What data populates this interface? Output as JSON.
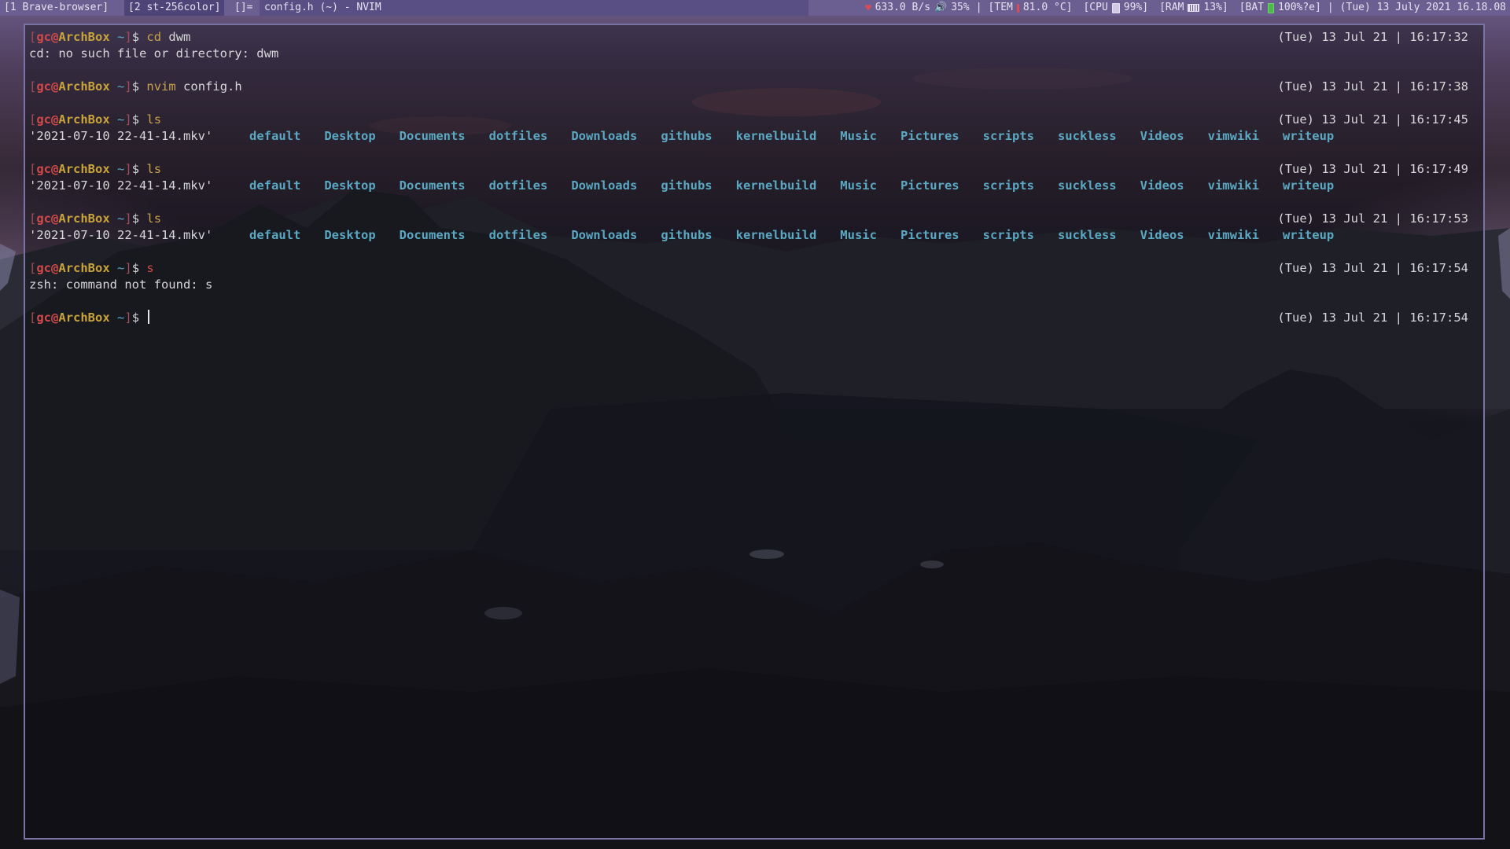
{
  "bar": {
    "tags": [
      {
        "label": "[1 Brave-browser]",
        "active": false
      },
      {
        "label": "[2 st-256color]",
        "active": true
      }
    ],
    "layout": "[]=",
    "window_title": "config.h (~) - NVIM",
    "status": {
      "net": "633.0 B/s",
      "volume": "35%",
      "sep1": "|",
      "temp_open": "[TEM",
      "temp": "81.0 °C]",
      "cpu_open": "[CPU",
      "cpu": "99%]",
      "ram_open": "[RAM",
      "ram": "13%]",
      "bat_open": "[BAT",
      "bat": "100%?e]",
      "sep2": "|",
      "datetime": "(Tue) 13 July 2021 16.18.08"
    },
    "colors": {
      "bar_bg": "#6b5f92",
      "active_tag_bg": "#4e4478",
      "title_bg": "#5a4f85"
    }
  },
  "terminal": {
    "prompt": {
      "open": "[",
      "user": "gc",
      "at": "@",
      "host": "ArchBox",
      "path": " ~",
      "close": "]",
      "dollar": "$ "
    },
    "entries": [
      {
        "command": "cd",
        "args": " dwm",
        "valid": true,
        "rprompt": "(Tue) 13 Jul 21 | 16:17:32",
        "output": "cd: no such file or directory: dwm"
      },
      {
        "command": "nvim",
        "args": " config.h",
        "valid": true,
        "rprompt": "(Tue) 13 Jul 21 | 16:17:38",
        "output": ""
      },
      {
        "command": "ls",
        "args": "",
        "valid": true,
        "rprompt": "(Tue) 13 Jul 21 | 16:17:45",
        "output": ""
      },
      {
        "command": "ls",
        "args": "",
        "valid": true,
        "rprompt": "(Tue) 13 Jul 21 | 16:17:49",
        "output": ""
      },
      {
        "command": "ls",
        "args": "",
        "valid": true,
        "rprompt": "(Tue) 13 Jul 21 | 16:17:53",
        "output": ""
      },
      {
        "command": "s",
        "args": "",
        "valid": false,
        "rprompt": "(Tue) 13 Jul 21 | 16:17:54",
        "output": "zsh: command not found: s"
      }
    ],
    "ls_listing": {
      "file": "'2021-07-10 22-41-14.mkv'",
      "dirs": [
        "default",
        "Desktop",
        "Documents",
        "dotfiles",
        "Downloads",
        "githubs",
        "kernelbuild",
        "Music",
        "Pictures",
        "scripts",
        "suckless",
        "Videos",
        "vimwiki",
        "writeup"
      ]
    },
    "current_rprompt": "(Tue) 13 Jul 21 | 16:17:54",
    "colors": {
      "directory": "#5aa8c2",
      "user": "#d14a4a",
      "host": "#c9a43c",
      "command": "#c9a24b",
      "border": "#7a74a6"
    }
  },
  "icons": [
    "heart-icon",
    "volume-icon",
    "thermometer-icon",
    "cpu-icon",
    "ram-icon",
    "battery-icon"
  ]
}
